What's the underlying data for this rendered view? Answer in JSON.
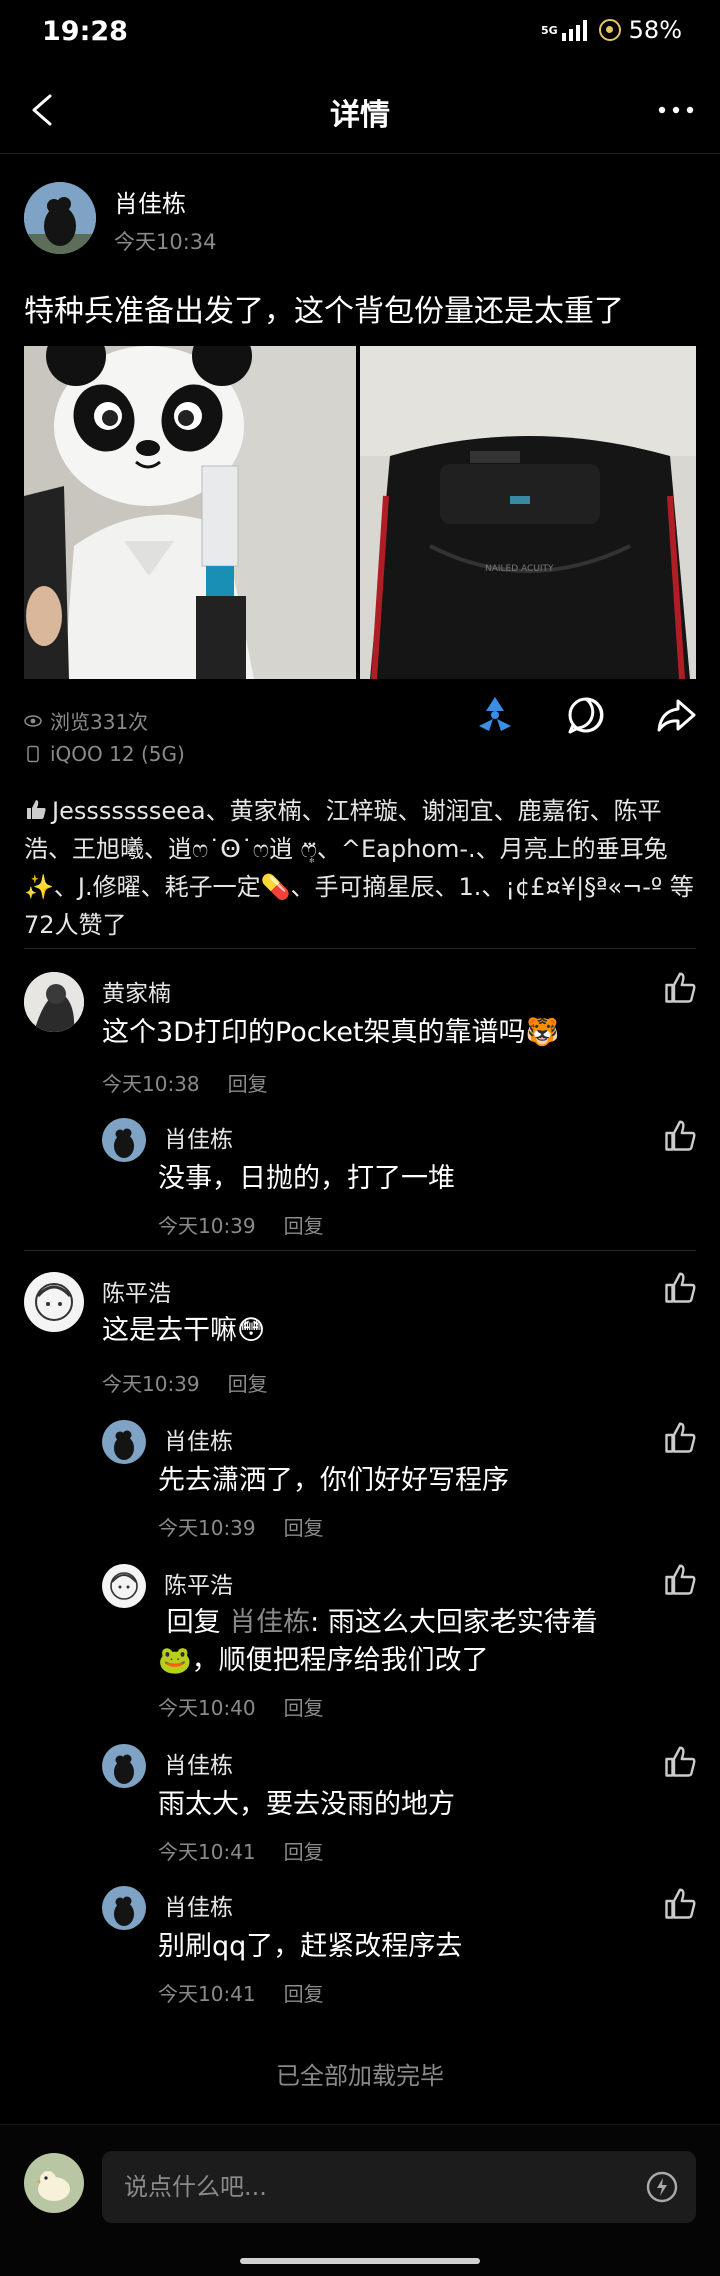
{
  "status_bar": {
    "time": "19:28",
    "network": "5G",
    "battery": "58%"
  },
  "header": {
    "title": "详情"
  },
  "post": {
    "author": "肖佳栋",
    "time": "今天10:34",
    "text": "特种兵准备出发了，这个背包份量还是太重了",
    "views": "浏览331次",
    "device": "iQOO 12 (5G)",
    "likes_text": "Jessssssseea、黄家楠、江梓璇、谢润宜、鹿嘉衔、陈平浩、王旭曦、逍ෆ˙Ꙫ˙ෆ逍 ෆ͙⃛、^Eaphom-.、月亮上的垂耳兔✨、J.修曜、耗子一定💊、手可摘星辰、1.、¡¢£¤¥|§ª«¬-º 等72人赞了"
  },
  "comments": [
    {
      "name": "黄家楠",
      "text": "这个3D打印的Pocket架真的靠谱吗🐯",
      "time": "今天10:38",
      "reply_label": "回复"
    },
    {
      "name": "肖佳栋",
      "text": "没事，日抛的，打了一堆",
      "time": "今天10:39",
      "reply_label": "回复"
    },
    {
      "name": "陈平浩",
      "text": "这是去干嘛😳",
      "time": "今天10:39",
      "reply_label": "回复"
    },
    {
      "name": "肖佳栋",
      "text": "先去潇洒了，你们好好写程序",
      "time": "今天10:39",
      "reply_label": "回复"
    },
    {
      "name": "陈平浩",
      "reply_prefix": " 回复 ",
      "reply_target": "肖佳栋",
      "text_line1": ": 雨这么大回家老实待着",
      "text_line2": "🐸，顺便把程序给我们改了",
      "time": "今天10:40",
      "reply_label": "回复"
    },
    {
      "name": "肖佳栋",
      "text": "雨太大，要去没雨的地方",
      "time": "今天10:41",
      "reply_label": "回复"
    },
    {
      "name": "肖佳栋",
      "text": "别刷qq了，赶紧改程序去",
      "time": "今天10:41",
      "reply_label": "回复"
    }
  ],
  "footer": {
    "end_text": "已全部加载完毕"
  },
  "input": {
    "placeholder": "说点什么吧..."
  }
}
